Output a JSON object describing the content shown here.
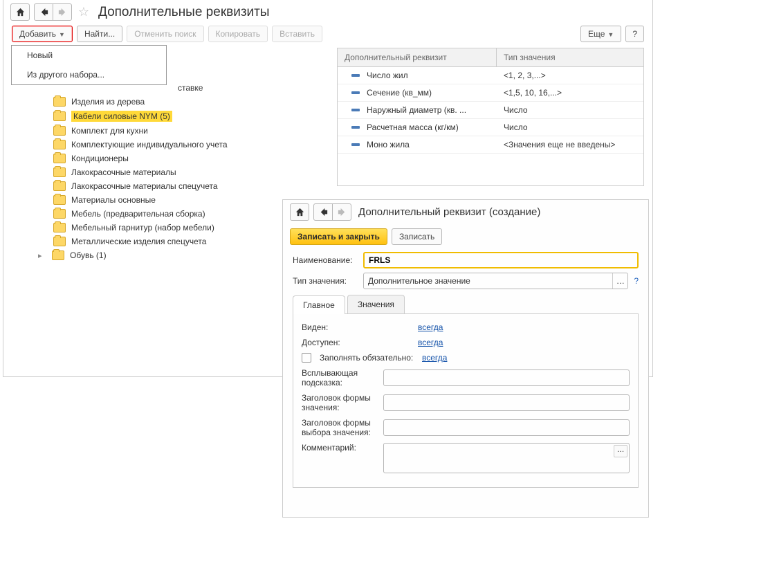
{
  "page_title": "Дополнительные реквизиты",
  "toolbar": {
    "add": "Добавить",
    "find": "Найти...",
    "cancel_search": "Отменить поиск",
    "copy": "Копировать",
    "paste": "Вставить",
    "more": "Еще",
    "help": "?"
  },
  "dropdown": {
    "new": "Новый",
    "from_other_set": "Из другого набора..."
  },
  "tree_partial": "ставке",
  "tree": [
    "Изделия из дерева",
    "Кабели силовые NYM (5)",
    "Комплект для кухни",
    "Комплектующие индивидуального учета",
    "Кондиционеры",
    "Лакокрасочные материалы",
    "Лакокрасочные материалы спецучета",
    "Материалы основные",
    "Мебель (предварительная сборка)",
    "Мебельный гарнитур (набор мебели)",
    "Металлические изделия спецучета",
    "Обувь (1)"
  ],
  "table": {
    "header_attr": "Дополнительный реквизит",
    "header_type": "Тип значения",
    "rows": [
      {
        "name": "Число жил",
        "type": "<1, 2, 3,...>"
      },
      {
        "name": "Сечение (кв_мм)",
        "type": "<1,5, 10, 16,...>"
      },
      {
        "name": "Наружный диаметр (кв. ...",
        "type": "Число"
      },
      {
        "name": "Расчетная масса (кг/км)",
        "type": "Число"
      },
      {
        "name": "Моно жила",
        "type": "<Значения еще не введены>"
      }
    ]
  },
  "modal": {
    "title": "Дополнительный реквизит (создание)",
    "save_close": "Записать и закрыть",
    "save": "Записать",
    "name_label": "Наименование:",
    "name_value": "FRLS",
    "type_label": "Тип значения:",
    "type_value": "Дополнительное значение",
    "tabs": {
      "main": "Главное",
      "values": "Значения"
    },
    "visible_label": "Виден:",
    "visible_value": "всегда",
    "available_label": "Доступен:",
    "available_value": "всегда",
    "required_label": "Заполнять обязательно:",
    "required_value": "всегда",
    "tooltip_label": "Всплывающая подсказка:",
    "value_form_label": "Заголовок формы значения:",
    "choice_form_label": "Заголовок формы выбора значения:",
    "comment_label": "Комментарий:"
  }
}
